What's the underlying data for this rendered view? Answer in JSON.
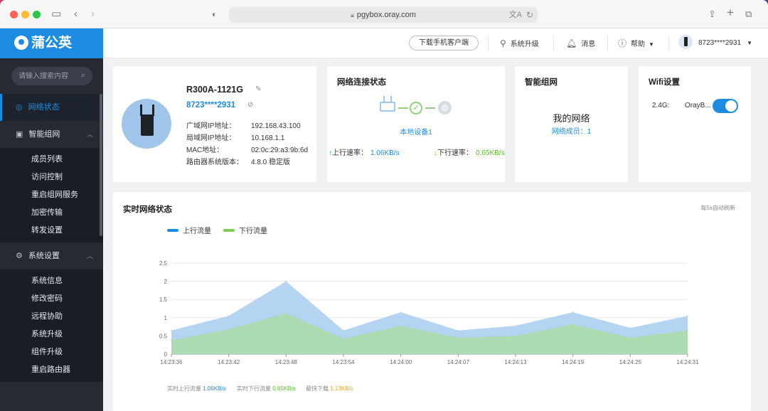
{
  "browser": {
    "url": "pgybox.oray.com"
  },
  "brand": {
    "name": "蒲公英"
  },
  "sidebar": {
    "search_placeholder": "请输入搜索内容",
    "groups": [
      {
        "label": "网络状态",
        "icon": "network-icon",
        "active": true
      },
      {
        "label": "智能组网",
        "icon": "mesh-icon",
        "items": [
          "成员列表",
          "访问控制",
          "重启组网服务",
          "加密传输",
          "转发设置"
        ]
      },
      {
        "label": "系统设置",
        "icon": "settings-icon",
        "items": [
          "系统信息",
          "修改密码",
          "远程协助",
          "系统升级",
          "组件升级",
          "重启路由器"
        ]
      }
    ]
  },
  "topbar": {
    "download_label": "下载手机客户端",
    "upgrade_label": "系统升级",
    "messages_label": "消息",
    "help_label": "帮助",
    "account": "8723****2931"
  },
  "device": {
    "name": "R300A-1121G",
    "id": "8723****2931",
    "fields": [
      {
        "key": "广域网IP地址：",
        "value": "192.168.43.100"
      },
      {
        "key": "局域网IP地址：",
        "value": "10.168.1.1"
      },
      {
        "key": "MAC地址：",
        "value": "02:0c:29:a3:9b:6d"
      },
      {
        "key": "路由器系统版本：",
        "value": "4.8.0 稳定版"
      }
    ]
  },
  "connection": {
    "title": "网络连接状态",
    "device_label": "本地设备1",
    "up_label": "上行速率：",
    "up_value": "1.06KB/s",
    "down_label": "下行速率：",
    "down_value": "0.65KB/s"
  },
  "mesh": {
    "title": "智能组网",
    "network_name": "我的网络",
    "members_label": "网络成员：",
    "members_count": "1"
  },
  "wifi": {
    "title": "Wifi设置",
    "band": "2.4G:",
    "ssid": "OrayB...",
    "enabled": true
  },
  "realtime": {
    "title": "实时网络状态",
    "refresh_note": "每5s自动刷新",
    "legend_up": "上行流量",
    "legend_down": "下行流量",
    "footer": {
      "up_label": "实时上行流量",
      "up_value": "1.06KB/s",
      "down_label": "实时下行流量",
      "down_value": "0.65KB/s",
      "max_label": "最快下载",
      "max_value": "1.13KB/s"
    }
  },
  "colors": {
    "accent": "#1d8ce0",
    "up_series": "#a8cdf0",
    "down_series": "#a9dca0",
    "max_speed": "#f5a623"
  },
  "chart_data": {
    "type": "area",
    "x": [
      "14:23:36",
      "14:23:42",
      "14:23:48",
      "14:23:54",
      "14:24:00",
      "14:24:07",
      "14:24:13",
      "14:24:19",
      "14:24:25",
      "14:24:31"
    ],
    "series": [
      {
        "name": "上行流量",
        "values": [
          0.65,
          1.05,
          2.0,
          0.65,
          1.15,
          0.65,
          0.78,
          1.15,
          0.72,
          1.05
        ]
      },
      {
        "name": "下行流量",
        "values": [
          0.38,
          0.68,
          1.12,
          0.42,
          0.78,
          0.45,
          0.5,
          0.82,
          0.45,
          0.65
        ]
      }
    ],
    "ylim": [
      0,
      2.5
    ],
    "yticks": [
      0,
      0.5,
      1,
      1.5,
      2,
      2.5
    ],
    "grid": true,
    "legend": "top-left"
  }
}
